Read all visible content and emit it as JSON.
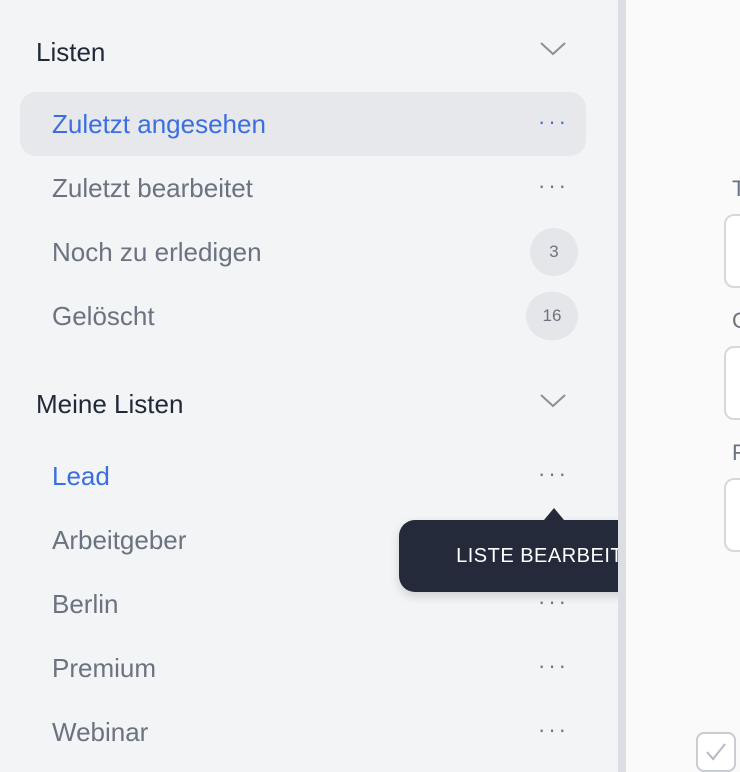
{
  "sidebar": {
    "sections": [
      {
        "title": "Listen",
        "items": [
          {
            "label": "Zuletzt angesehen"
          },
          {
            "label": "Zuletzt bearbeitet"
          },
          {
            "label": "Noch zu erledigen",
            "count": "3"
          },
          {
            "label": "Gelöscht",
            "count": "16"
          }
        ]
      },
      {
        "title": "Meine Listen",
        "items": [
          {
            "label": "Lead"
          },
          {
            "label": "Arbeitgeber"
          },
          {
            "label": "Berlin"
          },
          {
            "label": "Premium"
          },
          {
            "label": "Webinar"
          }
        ]
      }
    ]
  },
  "tooltip": {
    "text": "LISTE BEARBEITEN"
  },
  "main": {
    "field_labels": [
      "T",
      "C",
      "F"
    ]
  },
  "colors": {
    "accent": "#3b6fe0",
    "tooltip_bg": "#252a3b",
    "active_bg": "#e7e8eb"
  },
  "icons": {
    "chevron": "chevron-down-icon",
    "menu": "more-horizontal-icon",
    "check": "check-icon"
  }
}
